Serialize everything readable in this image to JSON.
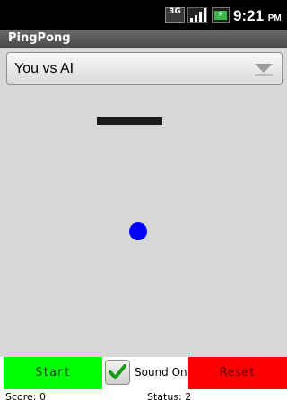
{
  "status_bar": {
    "network_label": "3G",
    "clock": "9:21",
    "ampm": "PM",
    "icons": [
      "network-3g-icon",
      "signal-strength-icon",
      "battery-charging-icon"
    ]
  },
  "app": {
    "title": "PingPong"
  },
  "mode_selector": {
    "selected": "You vs AI"
  },
  "game": {
    "field_color": "#d7d7d7",
    "paddle_color": "#1a1a1a",
    "ball_color": "#0000ff"
  },
  "controls": {
    "start_label": "Start",
    "start_color": "#00ff00",
    "sound_label": "Sound On",
    "sound_checked": true,
    "reset_label": "Reset",
    "reset_color": "#ff0000"
  },
  "info": {
    "score_text": "Score: 0",
    "status_text": "Status: 2"
  }
}
